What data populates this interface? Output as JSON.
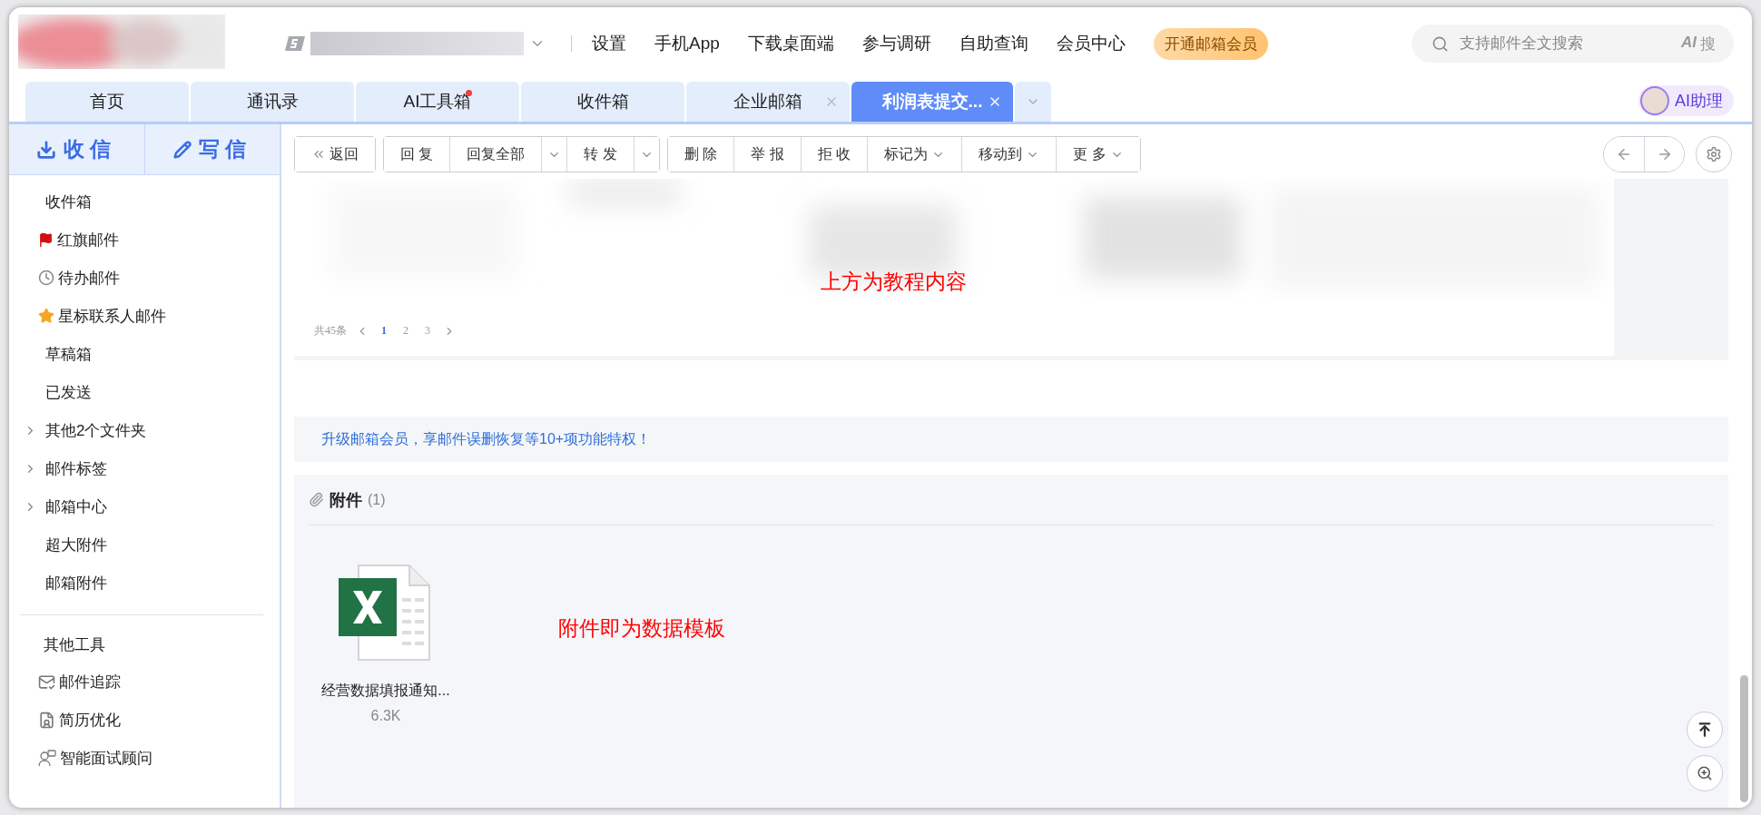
{
  "header": {
    "nav": [
      "设置",
      "手机App",
      "下载桌面端",
      "参与调研",
      "自助查询",
      "会员中心"
    ],
    "vip_badge": "开通邮箱会员",
    "search": {
      "placeholder": "支持邮件全文搜索",
      "ai_label": "AI",
      "ai_action": "搜"
    }
  },
  "tabs": [
    {
      "label": "首页",
      "selected": false,
      "closable": false,
      "dot": false
    },
    {
      "label": "通讯录",
      "selected": false,
      "closable": false,
      "dot": false
    },
    {
      "label": "AI工具箱",
      "selected": false,
      "closable": false,
      "dot": true
    },
    {
      "label": "收件箱",
      "selected": false,
      "closable": false,
      "dot": false
    },
    {
      "label": "企业邮箱",
      "selected": false,
      "closable": true,
      "dot": false
    },
    {
      "label": "利润表提交...",
      "selected": true,
      "closable": true,
      "dot": false
    }
  ],
  "assistant": "AI助理",
  "sidebar": {
    "receive": "收信",
    "compose": "写信",
    "folders": [
      {
        "label": "收件箱",
        "expandable": false
      },
      {
        "label": "红旗邮件",
        "expandable": false
      },
      {
        "label": "待办邮件",
        "expandable": false
      },
      {
        "label": "星标联系人邮件",
        "expandable": false
      },
      {
        "label": "草稿箱",
        "expandable": false
      },
      {
        "label": "已发送",
        "expandable": false
      },
      {
        "label": "其他2个文件夹",
        "expandable": true
      },
      {
        "label": "邮件标签",
        "expandable": true
      },
      {
        "label": "邮箱中心",
        "expandable": true
      },
      {
        "label": "超大附件",
        "expandable": false
      },
      {
        "label": "邮箱附件",
        "expandable": false
      }
    ],
    "tools_title": "其他工具",
    "tools": [
      "邮件追踪",
      "简历优化",
      "智能面试顾问"
    ]
  },
  "toolbar": {
    "groups": [
      [
        {
          "kind": "back",
          "label": "返回"
        }
      ],
      [
        {
          "kind": "text",
          "label": "回 复"
        },
        {
          "kind": "text",
          "label": "回复全部"
        },
        {
          "kind": "caret"
        },
        {
          "kind": "text",
          "label": "转 发"
        },
        {
          "kind": "caret"
        }
      ],
      [
        {
          "kind": "text",
          "label": "删 除"
        },
        {
          "kind": "text",
          "label": "举 报"
        },
        {
          "kind": "text",
          "label": "拒 收"
        },
        {
          "kind": "menu",
          "label": "标记为"
        },
        {
          "kind": "menu",
          "label": "移动到"
        },
        {
          "kind": "menu",
          "label": "更 多"
        }
      ]
    ]
  },
  "content": {
    "pagination": {
      "total": "共45条",
      "pages": [
        {
          "label": "1",
          "selected": true
        },
        {
          "label": "2",
          "selected": false
        },
        {
          "label": "3",
          "selected": false
        }
      ]
    },
    "note_top": "上方为教程内容",
    "promo": "升级邮箱会员，享邮件误删恢复等10+项功能特权！",
    "attachments": {
      "title": "附件",
      "count": "(1)",
      "note": "附件即为数据模板",
      "files": [
        {
          "name": "经营数据填报通知...",
          "size": "6.3K"
        }
      ]
    }
  }
}
